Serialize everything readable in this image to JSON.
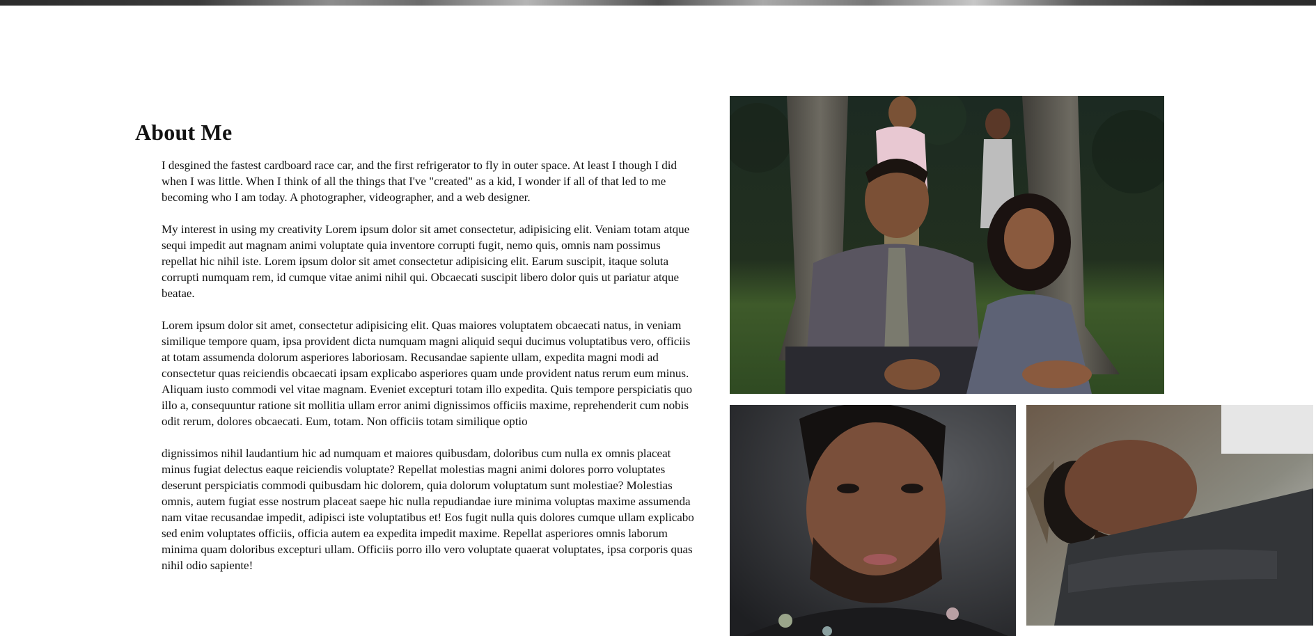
{
  "about": {
    "heading": "About Me",
    "paragraphs": [
      "I desgined the fastest cardboard race car, and the first refrigerator to fly in outer space. At least I though I did when I was little. When I think of all the things that I've \"created\" as a kid, I wonder if all of that led to me becoming who I am today. A photographer, videographer, and a web designer.",
      "My interest in using my creativity Lorem ipsum dolor sit amet consectetur, adipisicing elit. Veniam totam atque sequi impedit aut magnam animi voluptate quia inventore corrupti fugit, nemo quis, omnis nam possimus repellat hic nihil iste. Lorem ipsum dolor sit amet consectetur adipisicing elit. Earum suscipit, itaque soluta corrupti numquam rem, id cumque vitae animi nihil qui. Obcaecati suscipit libero dolor quis ut pariatur atque beatae.",
      "Lorem ipsum dolor sit amet, consectetur adipisicing elit. Quas maiores voluptatem obcaecati natus, in veniam similique tempore quam, ipsa provident dicta numquam magni aliquid sequi ducimus voluptatibus vero, officiis at totam assumenda dolorum asperiores laboriosam. Recusandae sapiente ullam, expedita magni modi ad consectetur quas reiciendis obcaecati ipsam explicabo asperiores quam unde provident natus rerum eum minus. Aliquam iusto commodi vel vitae magnam. Eveniet excepturi totam illo expedita. Quis tempore perspiciatis quo illo a, consequuntur ratione sit mollitia ullam error animi dignissimos officiis maxime, reprehenderit cum nobis odit rerum, dolores obcaecati. Eum, totam. Non officiis totam similique optio",
      "dignissimos nihil laudantium hic ad numquam et maiores quibusdam, doloribus cum nulla ex omnis placeat minus fugiat delectus eaque reiciendis voluptate? Repellat molestias magni animi dolores porro voluptates deserunt perspiciatis commodi quibusdam hic dolorem, quia dolorum voluptatum sunt molestiae? Molestias omnis, autem fugiat esse nostrum placeat saepe hic nulla repudiandae iure minima voluptas maxime assumenda nam vitae recusandae impedit, adipisci iste voluptatibus et! Eos fugit nulla quis dolores cumque ullam explicabo sed enim voluptates officiis, officia autem ea expedita impedit maxime. Repellat asperiores omnis laborum minima quam doloribus excepturi ullam. Officiis porro illo vero voluptate quaerat voluptates, ipsa corporis quas nihil odio sapiente!"
    ]
  },
  "photos": [
    {
      "id": "group",
      "subject": "four people posed by trees outdoors"
    },
    {
      "id": "portrait",
      "subject": "close-up portrait of a bearded man"
    },
    {
      "id": "lying",
      "subject": "man lying down with head on arm"
    }
  ],
  "colors": {
    "background": "#ffffff",
    "text": "#111111",
    "strip": "#2b2b2b"
  }
}
